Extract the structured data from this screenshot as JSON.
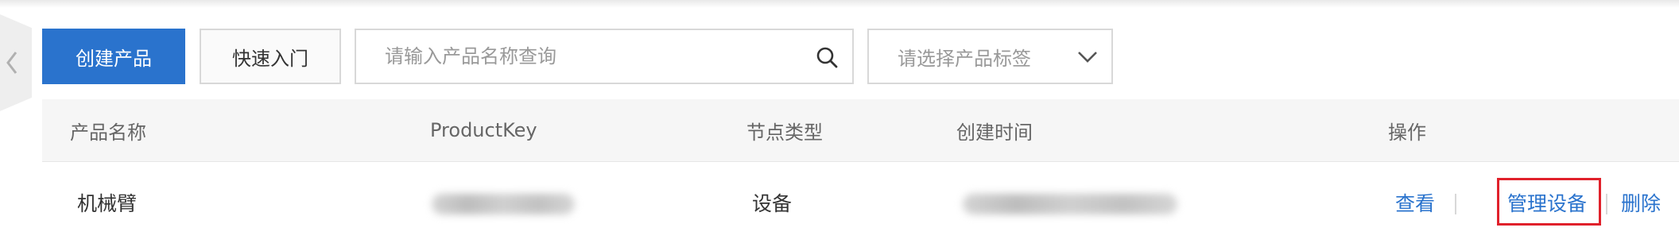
{
  "toolbar": {
    "create_button": "创建产品",
    "quick_start_button": "快速入门",
    "search_placeholder": "请输入产品名称查询",
    "tag_select_placeholder": "请选择产品标签"
  },
  "table": {
    "columns": [
      "产品名称",
      "ProductKey",
      "节点类型",
      "创建时间",
      "操作"
    ],
    "rows": [
      {
        "product_name": "机械臂",
        "node_type": "设备",
        "actions": {
          "view": "查看",
          "manage_devices": "管理设备",
          "delete": "删除"
        }
      }
    ]
  },
  "colors": {
    "primary": "#2a73cd",
    "highlight": "#e0212b"
  },
  "icons": {
    "collapse": "chevron-left-icon",
    "search": "search-icon",
    "select": "chevron-down-icon"
  }
}
